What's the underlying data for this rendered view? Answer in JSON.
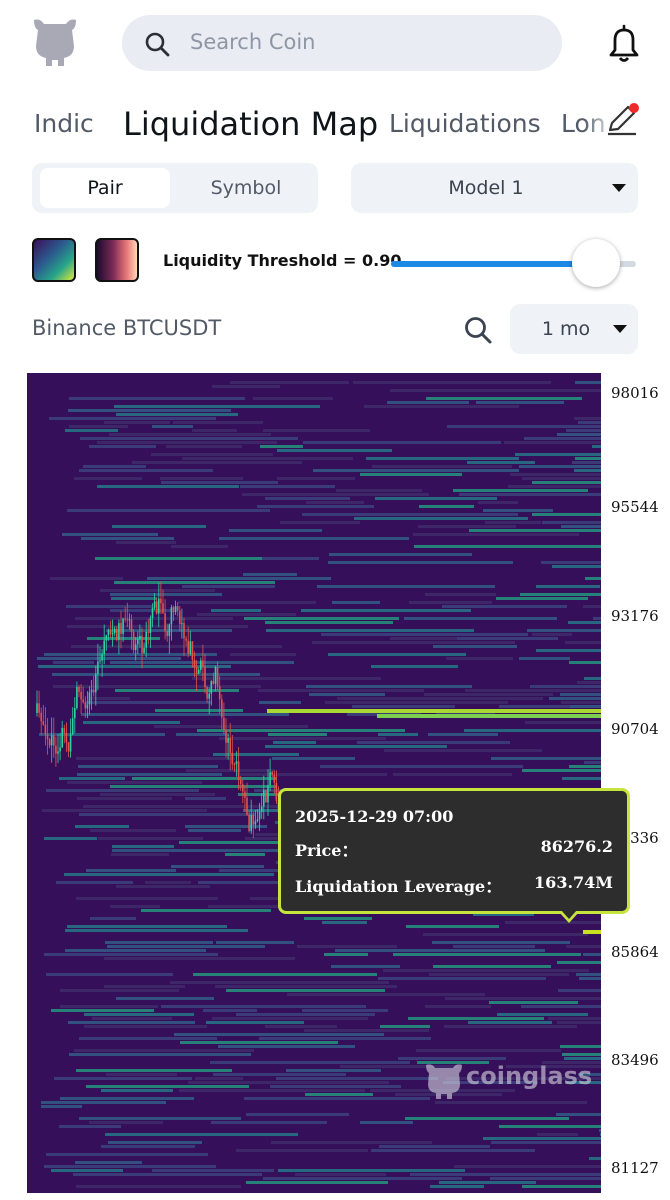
{
  "header": {
    "search_placeholder": "Search Coin",
    "logo_icon": "coinglass-mascot-icon",
    "notification_icon": "bell-icon"
  },
  "tabs": [
    "Indic",
    "Liquidation Map",
    "Liquidations",
    "Lon"
  ],
  "active_tab": "Liquidation Map",
  "tab_edit_icon": "pencil-icon",
  "segment": {
    "pair": "Pair",
    "symbol": "Symbol",
    "selected": "Pair"
  },
  "model": {
    "label": "Model 1"
  },
  "threshold": {
    "label": "Liquidity Threshold = 0.90",
    "value": 0.9
  },
  "pair_title": "Binance BTCUSDT",
  "period": {
    "label": "1 mo"
  },
  "axis": {
    "y_ticks": [
      "98016",
      "95544",
      "93176",
      "90704",
      "88336",
      "85864",
      "83496",
      "81127"
    ]
  },
  "tooltip": {
    "date": "2025-12-29 07:00",
    "price_label": "Price：",
    "price_value": "86276.2",
    "leverage_label": "Liquidation Leverage：",
    "leverage_value": "163.74M"
  },
  "watermark": "coinglass",
  "colors": {
    "heat_bg": "#360f5a",
    "accent_blue": "#1e88e5",
    "tooltip_border": "#c5e53d",
    "candle_up": "#2ad3a0",
    "candle_down": "#e5534b"
  }
}
